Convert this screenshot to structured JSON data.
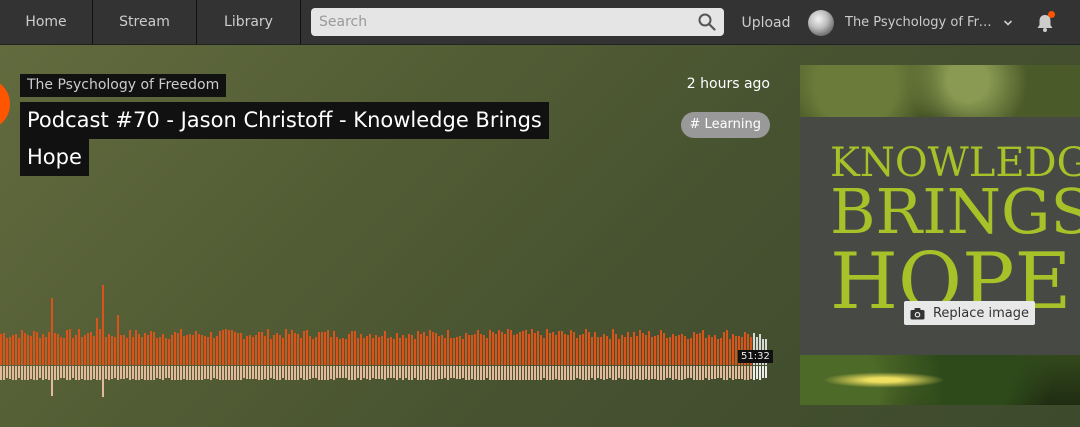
{
  "nav": {
    "home": "Home",
    "stream": "Stream",
    "library": "Library"
  },
  "search": {
    "placeholder": "Search",
    "value": ""
  },
  "header": {
    "upload": "Upload",
    "user_name": "The Psychology of Freedom",
    "user_name_display": "The Psychology of Fre…",
    "notification_indicator_color": "#ff5500"
  },
  "track": {
    "artist": "The Psychology of Freedom",
    "title_line1": "Podcast #70 - Jason Christoff - Knowledge Brings",
    "title_line2": "Hope",
    "posted": "2 hours ago",
    "tag": "# Learning",
    "duration": "51:32",
    "progress": 0.0
  },
  "artwork": {
    "line1": "KNOWLEDGE",
    "line2": "BRINGS",
    "line3": "HOPE",
    "replace_label": "Replace image"
  },
  "colors": {
    "accent": "#ff5500",
    "waveform_played": "#d9541a",
    "waveform_reflection": "#e3b99c",
    "artwork_text": "#a7c228",
    "header_bg": "#333333"
  },
  "icons": {
    "search": "search-icon",
    "chevron": "chevron-down-icon",
    "bell": "bell-icon",
    "camera": "camera-icon"
  }
}
